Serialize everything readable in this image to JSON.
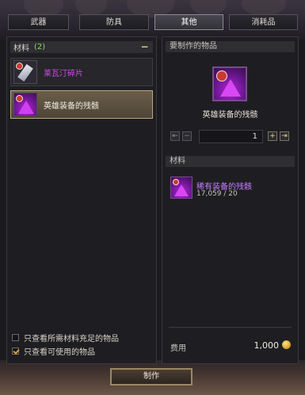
{
  "tabs": [
    {
      "label": "武器",
      "active": false
    },
    {
      "label": "防具",
      "active": false
    },
    {
      "label": "其他",
      "active": true
    },
    {
      "label": "消耗品",
      "active": false
    }
  ],
  "left": {
    "category": {
      "label": "材料",
      "count": "(2)",
      "collapse_symbol": "−"
    },
    "items": [
      {
        "label": "莱瓦汀碎片",
        "color": "#d14ee8",
        "icon": "sword-shard-icon",
        "selected": false
      },
      {
        "label": "英雄装备的残骸",
        "color": "#e8e2d6",
        "icon": "purple-remnant-icon",
        "selected": true
      }
    ],
    "filters": [
      {
        "label": "只查看所需材料充足的物品",
        "checked": false
      },
      {
        "label": "只查看可使用的物品",
        "checked": true
      }
    ]
  },
  "right": {
    "target_header": "要制作的物品",
    "target_name": "英雄装备的残骸",
    "quantity": "1",
    "qty_buttons": {
      "min": "⇤",
      "minus": "−",
      "plus": "+",
      "max": "⇥"
    },
    "materials_header": "材料",
    "materials": [
      {
        "name": "稀有装备的残骸",
        "count": "17,059 / 20",
        "color": "#c77dff"
      }
    ],
    "fee_label": "费用",
    "fee_value": "1,000"
  },
  "craft_button": "制作"
}
